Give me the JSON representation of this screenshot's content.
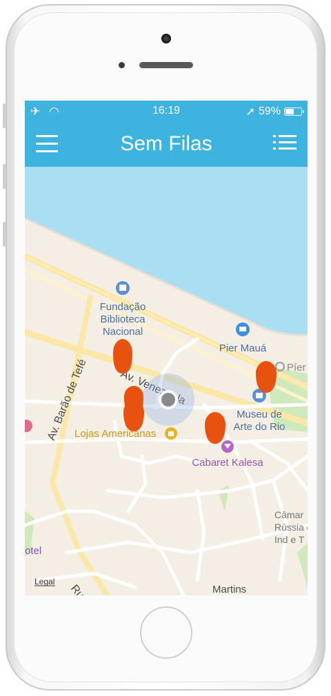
{
  "status_bar": {
    "time": "16:19",
    "battery": "59%",
    "battery_level": 0.59,
    "signal_icons": "airplane-and-wifi-icon",
    "location_icon": "location-arrow-icon"
  },
  "nav_bar": {
    "title": "Sem Filas",
    "left_icon": "hamburger-menu-icon",
    "right_icon": "list-icon",
    "color": "#3eb3e0"
  },
  "map": {
    "labels": {
      "fundacao_1": "Fundação",
      "fundacao_2": "Biblioteca",
      "fundacao_3": "Nacional",
      "pier_maua": "Pier Mauá",
      "pier_cut": "Píer",
      "museu_1": "Museu de",
      "museu_2": "Arte do Rio",
      "lojas": "Lojas Americanas",
      "cabaret": "Cabaret Kalesa",
      "av_venezuela": "Av. Venezuela",
      "av_barao": "Av. Barão de Tefé",
      "camara_1": "Câmar",
      "camara_2": "Rússia c",
      "camara_3": "Ind e T",
      "hotel": "otel",
      "rua": "Rua",
      "martins": "Martins",
      "legal": "Legal"
    },
    "pin_color": "#e8520f",
    "water_color": "#aadff3",
    "user_location": "current-location-dot"
  }
}
